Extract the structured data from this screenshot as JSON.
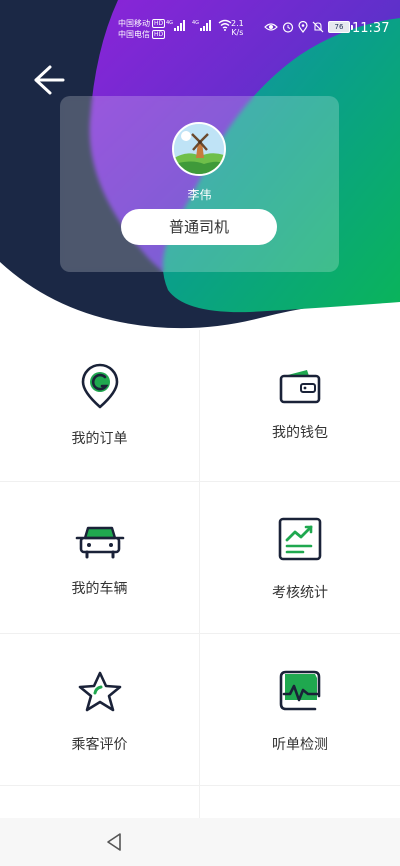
{
  "status_bar": {
    "carrier_1": "中国移动",
    "carrier_2": "中国电信",
    "hd_badge": "HD",
    "signal_type": "4G",
    "net_speed": "2.1",
    "net_speed_unit": "K/s",
    "battery_level": "76",
    "time": "11:37"
  },
  "profile": {
    "name": "李伟",
    "role": "普通司机"
  },
  "menu": {
    "items": [
      {
        "label": "我的订单",
        "icon": "location-order-icon"
      },
      {
        "label": "我的钱包",
        "icon": "wallet-icon"
      },
      {
        "label": "我的车辆",
        "icon": "car-icon"
      },
      {
        "label": "考核统计",
        "icon": "statistics-icon"
      },
      {
        "label": "乘客评价",
        "icon": "star-icon"
      },
      {
        "label": "听单检测",
        "icon": "waveform-icon"
      }
    ]
  },
  "colors": {
    "navy": "#1b2845",
    "purple": "#7a25d8",
    "teal": "#0f9ba0",
    "green": "#0ab45a",
    "icon_stroke": "#1a2238",
    "icon_accent": "#1fa84f"
  }
}
